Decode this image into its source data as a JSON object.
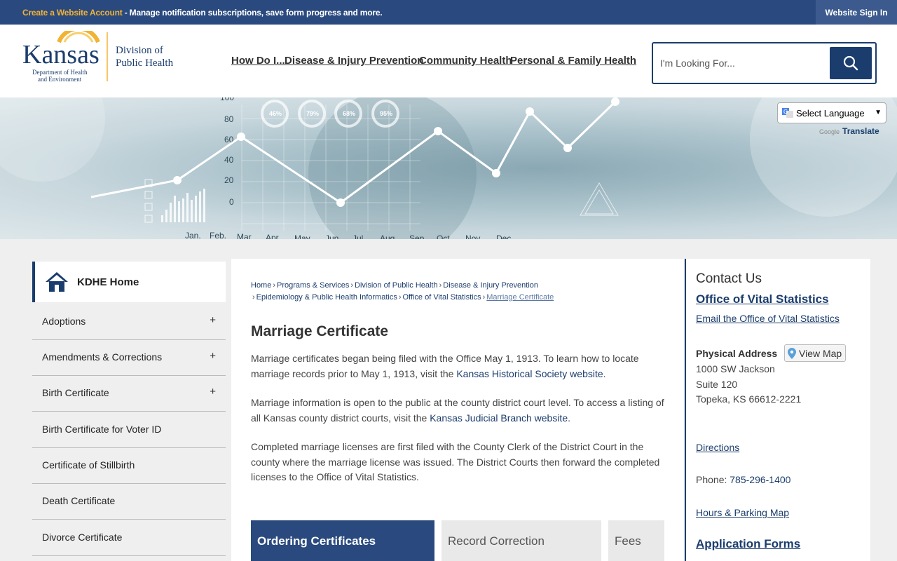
{
  "topbar": {
    "account_link": "Create a Website Account",
    "message": " - Manage notification subscriptions, save form progress and more.",
    "signin": "Website Sign In"
  },
  "logo": {
    "state": "Kansas",
    "dept_line1": "Department of Health",
    "dept_line2": "and Environment",
    "division_line1": "Division of",
    "division_line2": "Public Health"
  },
  "nav": {
    "items": [
      {
        "label": "How Do I..."
      },
      {
        "label": "Disease & Injury Prevention"
      },
      {
        "label": "Community Health"
      },
      {
        "label": "Personal & Family Health"
      }
    ]
  },
  "search": {
    "placeholder": "I'm Looking For..."
  },
  "translate": {
    "select_label": "Select Language",
    "powered_by": "Google",
    "link": "Translate"
  },
  "sidebar": {
    "home": "KDHE Home",
    "items": [
      {
        "label": "Adoptions",
        "expand": "+"
      },
      {
        "label": "Amendments & Corrections",
        "expand": "+"
      },
      {
        "label": "Birth Certificate",
        "expand": "+"
      },
      {
        "label": "Birth Certificate for Voter ID",
        "expand": ""
      },
      {
        "label": "Certificate of Stillbirth",
        "expand": ""
      },
      {
        "label": "Death Certificate",
        "expand": ""
      },
      {
        "label": "Divorce Certificate",
        "expand": ""
      }
    ]
  },
  "breadcrumb": {
    "items": [
      "Home",
      "Programs & Services",
      "Division of Public Health",
      "Disease & Injury Prevention",
      "Epidemiology & Public Health Informatics",
      "Office of Vital Statistics"
    ],
    "current": "Marriage Certificate",
    "separator": "›"
  },
  "page": {
    "title": "Marriage Certificate",
    "p1_text": "Marriage certificates began being filed with the Office May 1, 1913. To learn how to locate marriage records prior to May 1, 1913, visit the ",
    "p1_link": "Kansas Historical Society website",
    "p1_end": ".",
    "p2_text": "Marriage information is open to the public at the county district court level. To access a listing of all Kansas county district courts, visit the ",
    "p2_link": "Kansas Judicial Branch website",
    "p2_end": ".",
    "p3_text": "Completed marriage licenses are first filed with the County Clerk of the District Court in the county where the marriage license was issued. The District Courts then forward the completed licenses to the Office of Vital Statistics."
  },
  "tabs": [
    {
      "label": "Ordering Certificates"
    },
    {
      "label": "Record Correction"
    },
    {
      "label": "Fees"
    }
  ],
  "contact": {
    "heading": "Contact Us",
    "office": "Office of Vital Statistics",
    "email": "Email the Office of Vital Statistics",
    "address_label": "Physical Address",
    "view_map": "View Map",
    "address_line1": "1000 SW Jackson",
    "address_line2": "Suite 120",
    "address_line3": "Topeka, KS 66612-2221",
    "directions": "Directions",
    "phone_label": "Phone: ",
    "phone": "785-296-1400",
    "hours": "Hours & Parking Map",
    "forms": "Application Forms"
  },
  "banner": {
    "y_ticks": [
      "100",
      "80",
      "60",
      "40",
      "20",
      "0"
    ],
    "months": [
      "Jan.",
      "Feb.",
      "Mar",
      "Apr",
      "May",
      "Jun",
      "Jul",
      "Aug",
      "Sep",
      "Oct",
      "Nov",
      "Dec"
    ],
    "percents": [
      "46%",
      "79%",
      "68%",
      "95%"
    ]
  },
  "colors": {
    "brand_navy": "#1b3d6d",
    "topbar_blue": "#2a4a7f",
    "account_yellow": "#f2b233"
  }
}
